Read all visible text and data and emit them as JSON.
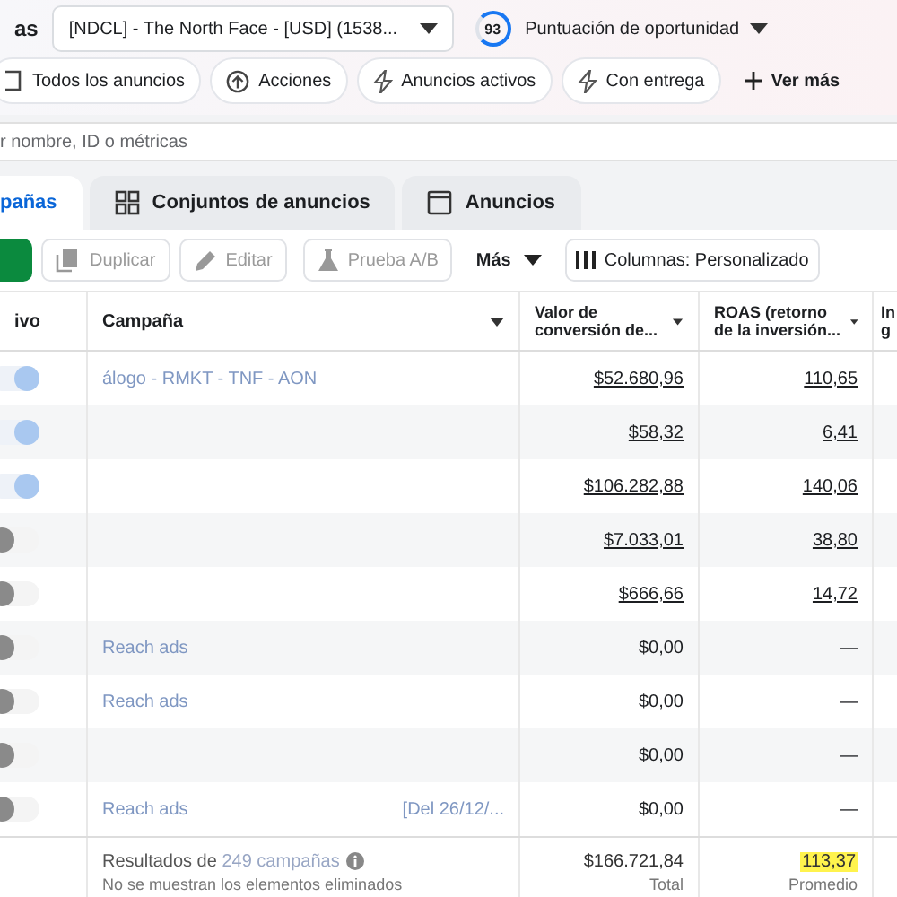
{
  "header": {
    "title": "as",
    "account": "[NDCL] - The North Face - [USD] (1538...",
    "score": "93",
    "score_label": "Puntuación de oportunidad"
  },
  "filters": [
    {
      "kind": "square",
      "label": "Todos los anuncios"
    },
    {
      "kind": "upload",
      "label": "Acciones"
    },
    {
      "kind": "bolt",
      "label": "Anuncios activos"
    },
    {
      "kind": "bolt",
      "label": "Con entrega"
    },
    {
      "kind": "plus",
      "label": "Ver más"
    }
  ],
  "search": {
    "placeholder": "r nombre, ID o métricas"
  },
  "tabs": [
    {
      "kind": "campaign",
      "label": "pañas",
      "selected": true
    },
    {
      "kind": "grid",
      "label": "Conjuntos de anuncios",
      "selected": false
    },
    {
      "kind": "window",
      "label": "Anuncios",
      "selected": false
    }
  ],
  "toolbar": [
    {
      "kind": "copy",
      "label": "Duplicar"
    },
    {
      "kind": "pencil",
      "label": "Editar"
    },
    {
      "kind": "flask",
      "label": "Prueba A/B"
    },
    {
      "kind": "menu",
      "label": "Más"
    },
    {
      "kind": "columns",
      "label": "Columnas: Personalizado"
    }
  ],
  "table": {
    "columns": [
      "ivo",
      "Campaña",
      "Valor de conversión de...",
      "ROAS (retorno de la inversión...",
      "In g"
    ],
    "rows": [
      {
        "on": true,
        "name": "álogo - RMKT - TNF - AON",
        "value": "$52.680,96",
        "roas": "110,65"
      },
      {
        "on": true,
        "name": "",
        "value": "$58,32",
        "roas": "6,41"
      },
      {
        "on": true,
        "name": "",
        "value": "$106.282,88",
        "roas": "140,06"
      },
      {
        "on": false,
        "name": "",
        "value": "$7.033,01",
        "roas": "38,80"
      },
      {
        "on": false,
        "name": "",
        "value": "$666,66",
        "roas": "14,72"
      },
      {
        "on": false,
        "name": "Reach ads",
        "value": "$0,00",
        "roas": "—"
      },
      {
        "on": false,
        "name": "Reach ads",
        "value": "$0,00",
        "roas": "—"
      },
      {
        "on": false,
        "name": "",
        "value": "$0,00",
        "roas": "—"
      },
      {
        "on": false,
        "name": "Reach ads",
        "extra": "[Del 26/12/...",
        "value": "$0,00",
        "roas": "—"
      }
    ],
    "footer": {
      "results_prefix": "Resultados de",
      "results_count": "249 campañas",
      "note": "No se muestran los elementos eliminados",
      "total": "$166.721,84",
      "total_label": "Total",
      "average": "113,37",
      "average_label": "Promedio"
    }
  }
}
